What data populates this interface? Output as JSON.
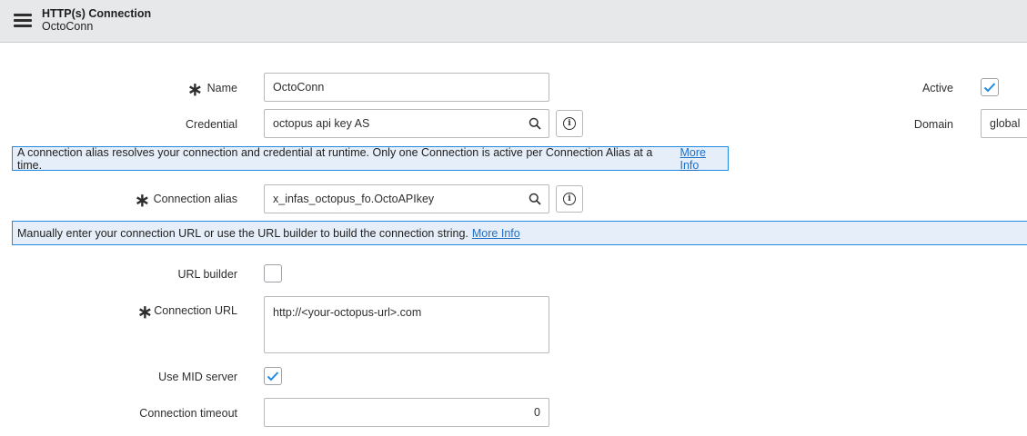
{
  "header": {
    "title": "HTTP(s) Connection",
    "subtitle": "OctoConn"
  },
  "form": {
    "name": {
      "label": "Name",
      "value": "OctoConn",
      "required": true
    },
    "credential": {
      "label": "Credential",
      "value": "octopus api key AS"
    },
    "active": {
      "label": "Active",
      "checked": true
    },
    "domain": {
      "label": "Domain",
      "value": "global"
    },
    "alias_banner": {
      "text": "A connection alias resolves your connection and credential at runtime. Only one Connection is active per Connection Alias at a time.",
      "link": "More Info"
    },
    "connection_alias": {
      "label": "Connection alias",
      "value": "x_infas_octopus_fo.OctoAPIkey",
      "required": true
    },
    "url_banner": {
      "text": "Manually enter your connection URL or use the URL builder to build the connection string.",
      "link": "More Info"
    },
    "url_builder": {
      "label": "URL builder",
      "checked": false
    },
    "connection_url": {
      "label": "Connection URL",
      "value": "http://<your-octopus-url>.com",
      "required": true
    },
    "use_mid_server": {
      "label": "Use MID server",
      "checked": true
    },
    "connection_timeout": {
      "label": "Connection timeout",
      "value": "0"
    }
  },
  "colors": {
    "accent": "#1f8ae0",
    "banner_bg": "#e6eff9",
    "header_bg": "#e6e8ea"
  },
  "icons": {
    "menu": "hamburger-icon",
    "lookup": "search-icon",
    "info": "info-icon",
    "required": "asterisk-icon",
    "check": "checkmark-icon"
  }
}
